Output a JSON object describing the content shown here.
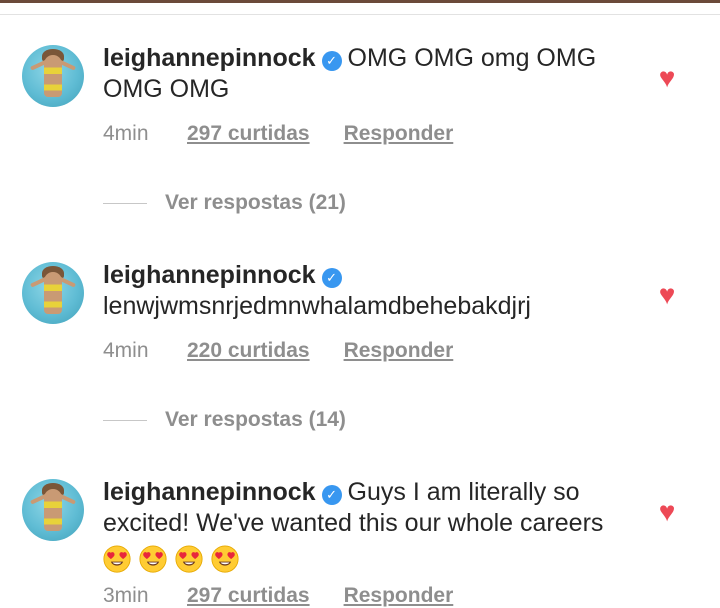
{
  "comments": [
    {
      "username": "leighannepinnock",
      "text": "OMG OMG omg OMG OMG OMG",
      "time": "4min",
      "likes": "297 curtidas",
      "reply": "Responder",
      "view_replies": "Ver respostas (21)"
    },
    {
      "username": "leighannepinnock",
      "text": "lenwjwmsnrjedmnwhalamdbehebakdjrj",
      "time": "4min",
      "likes": "220 curtidas",
      "reply": "Responder",
      "view_replies": "Ver respostas (14)"
    },
    {
      "username": "leighannepinnock",
      "text": "Guys I am literally so excited! We've wanted this our whole careers",
      "emoji_count": 4,
      "time": "3min",
      "likes": "297 curtidas",
      "reply": "Responder"
    }
  ],
  "icons": {
    "verified": "verified-badge-icon",
    "like": "heart-icon",
    "emoji": "heart-eyes-emoji-icon"
  },
  "colors": {
    "like_red": "#ed4956",
    "verified_blue": "#3897f0",
    "meta_gray": "#8e8e8e"
  }
}
